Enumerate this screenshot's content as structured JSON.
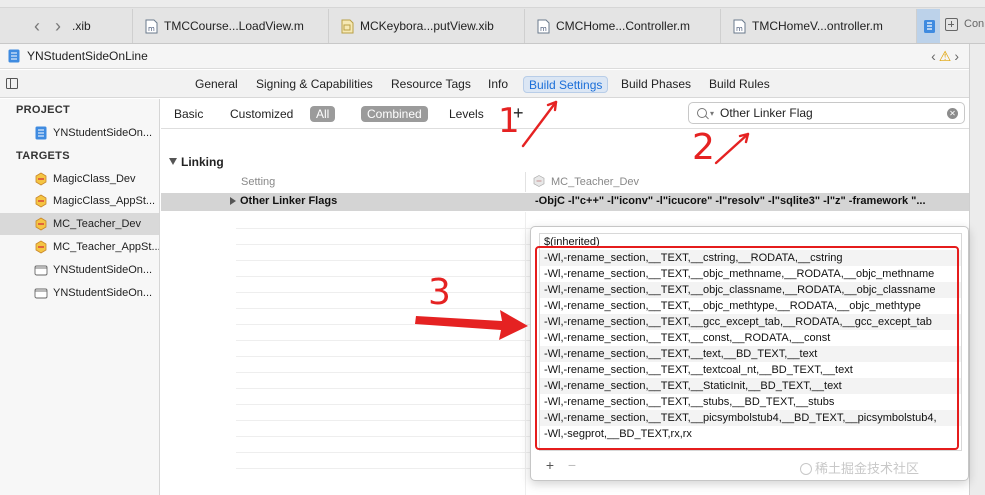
{
  "tabbar": {
    "partial_left": ".xib",
    "tabs": [
      {
        "label": "TMCCourse...LoadView.m",
        "icon": "objc-file-icon"
      },
      {
        "label": "MCKeybora...putView.xib",
        "icon": "xib-file-icon"
      },
      {
        "label": "CMCHome...Controller.m",
        "icon": "objc-file-icon"
      },
      {
        "label": "TMCHomeV...ontroller.m",
        "icon": "objc-file-icon"
      }
    ],
    "right_partial": "Con"
  },
  "pathbar": {
    "project_name": "YNStudentSideOnLine",
    "warning_symbol": "⚠"
  },
  "editor_tabs": [
    {
      "label": "General"
    },
    {
      "label": "Signing & Capabilities"
    },
    {
      "label": "Resource Tags"
    },
    {
      "label": "Info"
    },
    {
      "label": "Build Settings"
    },
    {
      "label": "Build Phases"
    },
    {
      "label": "Build Rules"
    }
  ],
  "navigator": {
    "project_header": "PROJECT",
    "project_item": "YNStudentSideOn...",
    "targets_header": "TARGETS",
    "targets": [
      {
        "label": "MagicClass_Dev",
        "icon": "app-target-icon"
      },
      {
        "label": "MagicClass_AppSt...",
        "icon": "app-target-icon"
      },
      {
        "label": "MC_Teacher_Dev",
        "icon": "app-target-icon"
      },
      {
        "label": "MC_Teacher_AppSt...",
        "icon": "app-target-icon"
      },
      {
        "label": "YNStudentSideOn...",
        "icon": "test-target-icon"
      },
      {
        "label": "YNStudentSideOn...",
        "icon": "test-target-icon"
      }
    ]
  },
  "filter": {
    "basic": "Basic",
    "customized": "Customized",
    "all": "All",
    "combined": "Combined",
    "levels": "Levels",
    "search_value": "Other Linker Flag"
  },
  "settings": {
    "section": "Linking",
    "col_setting": "Setting",
    "col_target": "MC_Teacher_Dev",
    "row_name": "Other Linker Flags",
    "row_value": "-ObjC -l\"c++\" -l\"iconv\" -l\"icucore\" -l\"resolv\" -l\"sqlite3\" -l\"z\" -framework \"..."
  },
  "popover": {
    "flags": [
      "$(inherited)",
      "-Wl,-rename_section,__TEXT,__cstring,__RODATA,__cstring",
      "-Wl,-rename_section,__TEXT,__objc_methname,__RODATA,__objc_methname",
      "-Wl,-rename_section,__TEXT,__objc_classname,__RODATA,__objc_classname",
      "-Wl,-rename_section,__TEXT,__objc_methtype,__RODATA,__objc_methtype",
      "-Wl,-rename_section,__TEXT,__gcc_except_tab,__RODATA,__gcc_except_tab",
      "-Wl,-rename_section,__TEXT,__const,__RODATA,__const",
      "-Wl,-rename_section,__TEXT,__text,__BD_TEXT,__text",
      "-Wl,-rename_section,__TEXT,__textcoal_nt,__BD_TEXT,__text",
      "-Wl,-rename_section,__TEXT,__StaticInit,__BD_TEXT,__text",
      "-Wl,-rename_section,__TEXT,__stubs,__BD_TEXT,__stubs",
      "-Wl,-rename_section,__TEXT,__picsymbolstub4,__BD_TEXT,__picsymbolstub4,",
      "-Wl,-segprot,__BD_TEXT,rx,rx"
    ],
    "add_symbol": "+",
    "remove_symbol": "−"
  },
  "annotations": {
    "step1": "1",
    "step2": "2",
    "step3": "3",
    "plus_symbol": "+",
    "color": "#e52222"
  },
  "watermark": "稀土掘金技术社区",
  "colors": {
    "accent": "#1a6ed8",
    "selected_tab_bg": "#dbe6f4",
    "annotation_red": "#e52222"
  }
}
